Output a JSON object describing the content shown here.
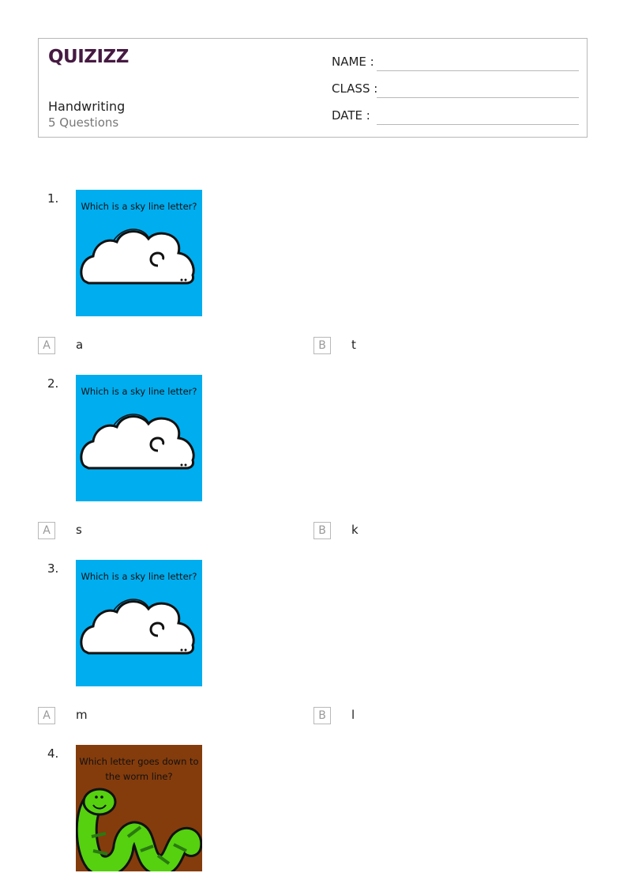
{
  "header": {
    "logo": "QUIZIZZ",
    "title": "Handwriting",
    "subtitle": "5 Questions",
    "fields": [
      "NAME :",
      "CLASS :",
      "DATE  :"
    ]
  },
  "questions": [
    {
      "number": "1.",
      "image_text": "Which is a sky line letter?",
      "image_bg": "#00adee",
      "image_icon": "cloud-icon",
      "options": [
        {
          "letter": "A",
          "text": "a"
        },
        {
          "letter": "B",
          "text": "t"
        }
      ]
    },
    {
      "number": "2.",
      "image_text": "Which is a sky line letter?",
      "image_bg": "#00adee",
      "image_icon": "cloud-icon",
      "options": [
        {
          "letter": "A",
          "text": "s"
        },
        {
          "letter": "B",
          "text": "k"
        }
      ]
    },
    {
      "number": "3.",
      "image_text": "Which is a sky line letter?",
      "image_bg": "#00adee",
      "image_icon": "cloud-icon",
      "options": [
        {
          "letter": "A",
          "text": "m"
        },
        {
          "letter": "B",
          "text": "l"
        }
      ]
    },
    {
      "number": "4.",
      "image_text_lines": [
        "Which letter goes down to",
        "the worm line?"
      ],
      "image_bg": "#843c0c",
      "image_icon": "worm-icon"
    }
  ]
}
